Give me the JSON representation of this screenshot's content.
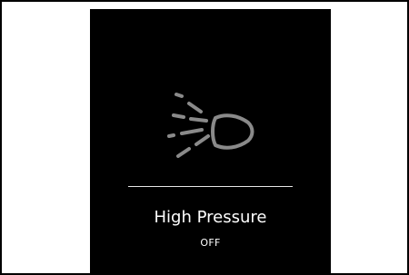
{
  "control": {
    "title": "High Pressure",
    "status": "OFF",
    "icon": "high-pressure-nozzle-icon"
  },
  "colors": {
    "page_background": "#ffffff",
    "frame_border": "#000000",
    "tile_background": "#000000",
    "icon_stroke": "#8a8a8a",
    "text": "#ffffff",
    "divider": "#e6e6e6"
  }
}
